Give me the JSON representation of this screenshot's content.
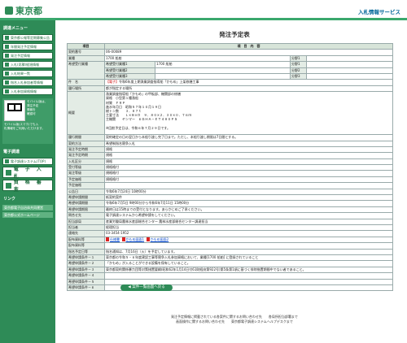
{
  "header": {
    "logo_text": "東京都",
    "top_link": "入札情報サービス"
  },
  "sidebar": {
    "section_menu": "調達メニュー",
    "items": [
      {
        "label": "東京都公報等定期募集公告"
      },
      {
        "label": "年間発注予定情報"
      },
      {
        "label": "発注予定情報"
      },
      {
        "label": "入札(見積)経過情報"
      },
      {
        "label": "入札結果一覧"
      },
      {
        "label": "指名入札参加者等情報"
      },
      {
        "label": "入札参加資格情報"
      }
    ],
    "mobile_side": [
      "モバイル版は、",
      "発注予定",
      "情報を",
      "確認可"
    ],
    "mobile_text": [
      "モバイル版(スマホ)でも入",
      "札情報をご利用いただけます。"
    ],
    "section_ext": "電子調達",
    "big_items": [
      {
        "label": "電子調達システム(TOP)"
      },
      {
        "label": "電　子　入　札"
      },
      {
        "label": "資　格　審　査"
      }
    ],
    "section_links": "リンク",
    "links": [
      "東京都電子自治体共同運営",
      "東京都公式ホームページ"
    ]
  },
  "page_title": "発注予定表",
  "table_header": {
    "item": "項目",
    "content": "項　目　内　容"
  },
  "rows": [
    {
      "label": "契約番号",
      "value": "06-00089"
    },
    {
      "label": "業種",
      "value": "1700 船舶",
      "sub_label": "分野1",
      "sub_value": ""
    },
    {
      "label": "希望受付業種",
      "sub_rows": [
        {
          "k": "希望受付業種1",
          "v": "1700 船舶",
          "s": "分野1"
        },
        {
          "k": "希望受付業種2",
          "v": "",
          "s": "分野2"
        },
        {
          "k": "希望受付業種3",
          "v": "",
          "s": "分野3"
        }
      ]
    },
    {
      "label": "件　名",
      "badge": "【電子】",
      "value": "令和6年度上期漁業調査指導船「かもめ」上架修繕工事"
    },
    {
      "label": "履行場所",
      "value": "都が指定する場所"
    },
    {
      "label": "概要",
      "block": "漁業調査指導船「かもめ」の甲板部、機関部の修繕\n資格　小型第１種漁船\n材質　ＦＲＰ\n進水年月日　昭和５７年１０月１９日\n総トン数　　３．８７ｔ\n主要寸法　　Ｌ×Ｂ×Ｄ　９．８０×２．３０×０．７６ｍ\n主機関　　ヤンマー　６ＧＨＡ－ＥＴ４８０ＰＳ\n\n※回航予定日は、令和６年７月２９日です。"
    },
    {
      "label": "履行期間",
      "value": "契約確定の日の翌日から本船引渡し完了日まで。ただし、本船引渡し期限は7日間とする。"
    },
    {
      "label": "契約方法",
      "value": "希望制指名競争入札"
    },
    {
      "label": "発注予定時期",
      "value": "規格"
    },
    {
      "label": "発注予定時期",
      "value": "規格"
    },
    {
      "label": "入札区分",
      "value": "規格"
    },
    {
      "label": "受付等級",
      "value": "規格格付"
    },
    {
      "label": "発注等級",
      "value": "規格格付"
    },
    {
      "label": "予定価格",
      "value": "規格格付"
    },
    {
      "label": "予定価格",
      "value": ""
    },
    {
      "label": "公告日",
      "value": "令和6年7月24日 10時00分"
    },
    {
      "label": "希望申請期間",
      "value": "紙契約案件"
    },
    {
      "label": "希望申請期間",
      "value": "令和6年7月5日 9時00分から令和6年7月11日 15時00分"
    },
    {
      "label": "希望申請期限",
      "value": "最終日は15時までの受付となります。あらかじめご了承ください。"
    },
    {
      "label": "問合せ先",
      "value": "電子調達システムから希望申請をしてください。"
    },
    {
      "label": "担当部局",
      "value": "産業労働局農林水産部総合センター 農林水産部総合センター調達担当"
    },
    {
      "label": "担当者",
      "value": "経理担当"
    },
    {
      "label": "連絡先",
      "value": "03-3454-1952"
    },
    {
      "label": "配布資料等",
      "files": [
        "仕様書",
        "かもめ図面1",
        "かもめ図面2"
      ]
    },
    {
      "label": "配布資料等",
      "value": ""
    },
    {
      "label": "指名予定日等",
      "value": "指名通知は、7月16日（火）を予定しています。"
    },
    {
      "label": "希望申請条件－１",
      "value": "東京都の令和５・６年度建設工事等競争入札参加資格において、業種[1700 船舶] に登録されていること"
    },
    {
      "label": "希望申請条件－２",
      "value": "「かもめ」が入ることができる設備を保有していること。"
    },
    {
      "label": "希望申請条件－３",
      "value": "東京都契約関係暴力団等対策措置要綱(昭和62年1月14日付61財経庶第922号)第5条第1項に基づく排除措置期間中でない者であること。"
    },
    {
      "label": "希望申請条件－４",
      "value": ""
    },
    {
      "label": "希望申請条件－５",
      "value": ""
    },
    {
      "label": "希望申請条件－６",
      "value": ""
    }
  ],
  "return_button": "案件一覧画面へ戻る",
  "footer": [
    "発注予定情報に掲載されている各案件に関するお問い合わせ先　　各局所担当部署まで",
    "画面操作に関するお問い合わせ先　　東京都電子調達システムヘルプデスクまで"
  ]
}
